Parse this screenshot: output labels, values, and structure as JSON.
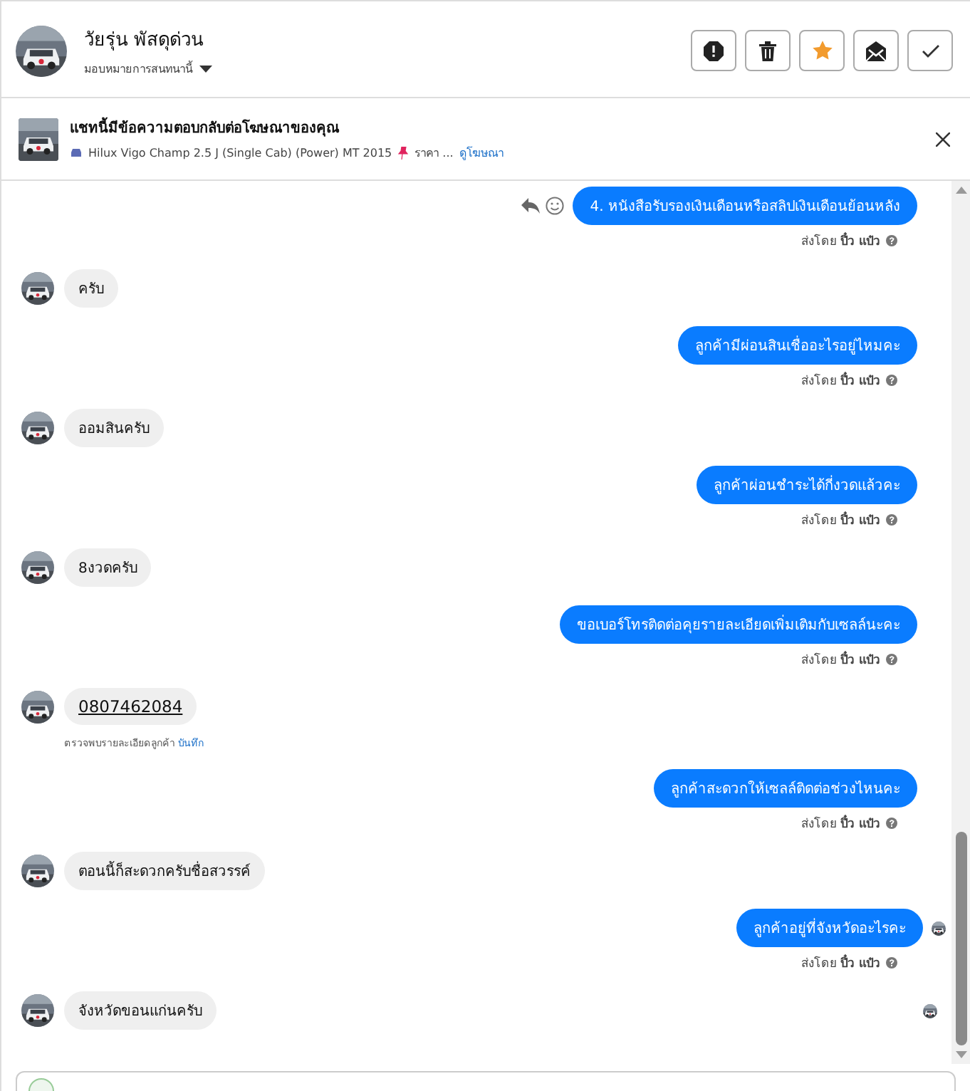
{
  "header": {
    "name": "วัยรุ่น พัสดุด่วน",
    "assign": "มอบหมายการสนทนานี้",
    "actions": [
      {
        "kind": "alert"
      },
      {
        "kind": "trash"
      },
      {
        "kind": "star"
      },
      {
        "kind": "mail"
      },
      {
        "kind": "check"
      }
    ]
  },
  "ad": {
    "title": "แชทนี้มีข้อความตอบกลับต่อโฆษณาของคุณ",
    "listing": "Hilux Vigo Champ 2.5 J (Single Cab) (Power) MT 2015",
    "price": "ราคา ...",
    "link": "ดูโฆษณา"
  },
  "messages": [
    {
      "kind": "out",
      "text": "4. หนังสือรับรองเงินเดือนหรือสลิปเงินเดือนย้อนหลัง",
      "sent_by": "ส่งโดย **ปิ๋ว แป๋ว**",
      "hovered": true,
      "seen": false
    },
    {
      "kind": "in",
      "text": "ครับ",
      "seen": false
    },
    {
      "kind": "out",
      "text": "ลูกค้ามีผ่อนสินเชื่ออะไรอยู่ไหมคะ",
      "sent_by": "ส่งโดย **ปิ๋ว แป๋ว**",
      "hovered": false,
      "seen": false
    },
    {
      "kind": "in",
      "text": "ออมสินครับ",
      "seen": false
    },
    {
      "kind": "out",
      "text": "ลูกค้าผ่อนชำระได้กี่งวดแล้วคะ",
      "sent_by": "ส่งโดย **ปิ๋ว แป๋ว**",
      "hovered": false,
      "seen": false
    },
    {
      "kind": "in",
      "text": "8งวดครับ",
      "seen": false
    },
    {
      "kind": "out",
      "text": "ขอเบอร์โทรติดต่อคุยรายละเอียดเพิ่มเติมกับเซลล์นะคะ",
      "sent_by": "ส่งโดย **ปิ๋ว แป๋ว**",
      "hovered": false,
      "seen": false
    },
    {
      "kind": "phone",
      "text": "0807462084",
      "note": "ตรวจพบรายละเอียดลูกค้า",
      "note_link": "บันทึก"
    },
    {
      "kind": "out",
      "text": "ลูกค้าสะดวกให้เซลล์ติดต่อช่วงไหนคะ",
      "sent_by": "ส่งโดย **ปิ๋ว แป๋ว**",
      "hovered": false,
      "seen": false
    },
    {
      "kind": "in",
      "text": "ตอนนี้ก็สะดวกครับชื่อสวรรค์",
      "seen": false
    },
    {
      "kind": "out",
      "text": "ลูกค้าอยู่ที่จังหวัดอะไรคะ",
      "sent_by": "ส่งโดย **ปิ๋ว แป๋ว**",
      "hovered": false,
      "seen": true
    },
    {
      "kind": "in",
      "text": "จังหวัดขอนแก่นครับ",
      "seen": true
    }
  ]
}
